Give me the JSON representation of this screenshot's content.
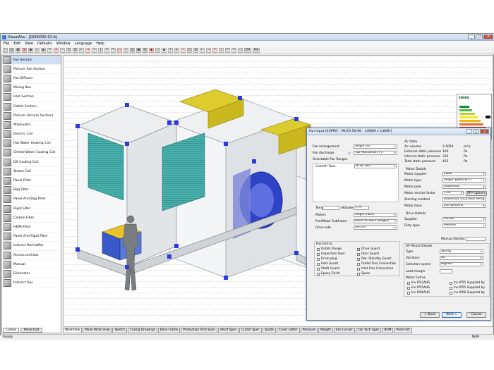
{
  "window": {
    "title": "VisualAhu - [Q000000-01-A]"
  },
  "menu": [
    "File",
    "Edit",
    "View",
    "Defaults",
    "Window",
    "Language",
    "Help"
  ],
  "toolbar_icons": [
    "new-icon",
    "open-icon",
    "save-icon",
    "print-icon",
    "cut-icon",
    "copy-icon",
    "paste-icon",
    "help-icon",
    "zoom-in-icon",
    "zoom-out-icon",
    "zoom-fit-icon",
    "zoom-window-icon",
    "arrow-left-icon",
    "arrow-right-icon",
    "arrow-up-icon",
    "arrow-down-icon",
    "rotate-left-icon",
    "rotate-right-icon",
    "view-front-icon",
    "view-side-icon",
    "view-top-icon",
    "view-iso-icon",
    "grid-icon",
    "wire-icon",
    "shade-icon",
    "flip-icon",
    "section-icon",
    "measure-icon",
    "hide-icon",
    "show-icon",
    "color-icon",
    "layer-icon",
    "pdf-icon",
    "calc-icon",
    "report-icon",
    "export-icon",
    "pen-icon",
    "settings-icon"
  ],
  "toolbar_text": [
    "DA",
    "RA"
  ],
  "components": [
    "Fan Section",
    "Plenum Fan Section",
    "Fan Diffuser",
    "Mixing Box",
    "Inlet Section",
    "Outlet Section",
    "Plenum (Access Section)",
    "Attenuator",
    "Electric Coil",
    "Hot Water Heating Coil",
    "Chilled Water Cooling Coil",
    "DX Cooling Coil",
    "Steam Coil",
    "Panel Filter",
    "Bag Filter",
    "Panel And Bag Filter",
    "Rigid Filter",
    "Carbon Filter",
    "HEPA Filter",
    "Panel And Rigid Filter",
    "Indirect Humidifier",
    "Access and box",
    "Manual",
    "Eliminator",
    "Indirect Gas"
  ],
  "left_tabs": [
    "Comps",
    "Panel Edit"
  ],
  "bottom_tabs": [
    "WorkView",
    "Panel Work View",
    "Sketch",
    "Casing Drawings",
    "Base Frame",
    "Production Tech Spec",
    "Short Spec",
    "Cutlist Spec",
    "Quote",
    "Cover Letter",
    "Pressure",
    "Weight",
    "Fan Curves",
    "Coil Tech Spec",
    "BOM",
    "Panel list"
  ],
  "status": {
    "left": "Ready",
    "right": "NUM"
  },
  "energy_label": {
    "title": "ENERG"
  },
  "dialog": {
    "title": "Fan Input [SUPPLY - MU70-50-06 - 1466W x 1460H]",
    "fan_arrangement_label": "Fan arrangement",
    "fan_arrangement": "Single Fan",
    "fan_discharge_label": "Fan discharge",
    "fan_discharge": "Top Horizontal (FT)",
    "selectable_ranges_label": "Selectable Fan Ranges",
    "selected_range": "Comefri Fans",
    "selected_model": "NTHZ (BC)",
    "temp_label": "Temp",
    "altitude_label": "Altitude",
    "altitude_value": "0.00",
    "motors_label": "Motors",
    "motors": "Single motor",
    "subframe_label": "Fan/Motor Subframe",
    "subframe": "Motor at Back (Single)",
    "drive_side_label": "Drive side",
    "drive_side": "Left Air",
    "air_data_label": "Air Data",
    "air_rows": [
      {
        "label": "Air volume",
        "value": "2.5000",
        "unit": "m³/s"
      },
      {
        "label": "External static pressure",
        "value": "100",
        "unit": "Pa"
      },
      {
        "label": "Internal static pressure",
        "value": "335",
        "unit": "Pa"
      },
      {
        "label": "Total static pressure",
        "value": "435",
        "unit": "Pa"
      }
    ],
    "motor_details_label": "Motor Details",
    "motor_rows": [
      {
        "label": "Motor supplier",
        "value": "FLEM"
      },
      {
        "label": "Motor type",
        "value": "Single Speed EFF1"
      },
      {
        "label": "Motor pole",
        "value": "Automatic"
      },
      {
        "label": "Motor service factor",
        "value": "1.30"
      },
      {
        "label": "Starting method",
        "value": "Automatic (DOL/Star delta"
      },
      {
        "label": "Motor base",
        "value": "Fan Systems"
      }
    ],
    "sfp_button": "SFP Options",
    "drive_details_label": "Drive Details",
    "drive_rows": [
      {
        "label": "Supplier",
        "value": "Fenner"
      },
      {
        "label": "Duty type",
        "value": "Medium"
      }
    ],
    "manual_label": "Manual DenDst",
    "fan_extras_label": "Fan Extras",
    "fan_extras_left": [
      {
        "label": "Outlet Flange",
        "checked": false
      },
      {
        "label": "Inspection Door",
        "checked": false
      },
      {
        "label": "Drain plug",
        "checked": false
      },
      {
        "label": "Inlet Guard",
        "checked": false
      },
      {
        "label": "Shaft Guard",
        "checked": false
      },
      {
        "label": "Epoxy Finish",
        "checked": false
      }
    ],
    "fan_extras_right": [
      {
        "label": "Drive Guard",
        "checked": true
      },
      {
        "label": "Door Guard",
        "checked": false
      },
      {
        "label": "Pwr. Standby Guard",
        "checked": false
      },
      {
        "label": "Outlet Flex Connection",
        "checked": false
      },
      {
        "label": "Inlet Flex Connection",
        "checked": false
      },
      {
        "label": "Spare",
        "checked": false
      }
    ],
    "av_mount_label": "AV Mount Details",
    "av_rows": [
      {
        "label": "Type",
        "value": "Spring"
      },
      {
        "label": "Variation",
        "value": "All"
      },
      {
        "label": "Selection speed",
        "value": "Highest"
      }
    ],
    "load_margin_label": "Load margin",
    "motor_extras_label": "Motor Extras",
    "motor_extras": [
      {
        "label": "Inv IP23AHS",
        "checked": false
      },
      {
        "label": "Inv IP55 Supplied by",
        "checked": false
      },
      {
        "label": "Inv IP55AHS",
        "checked": false
      },
      {
        "label": "Inv IP55 Supplied by",
        "checked": false
      },
      {
        "label": "Inv IP66AHS",
        "checked": false
      },
      {
        "label": "Inv IP66 Supplied by",
        "checked": false
      }
    ],
    "back_button": "< Back",
    "next_button": "Next >",
    "cancel_button": "Cancel"
  },
  "colors": {
    "frame_blue": "#2b3bdc",
    "coil_teal": "#3fa9a8",
    "filter_yellow": "#d9cb2a",
    "panel_grey": "#cfd3d6"
  }
}
